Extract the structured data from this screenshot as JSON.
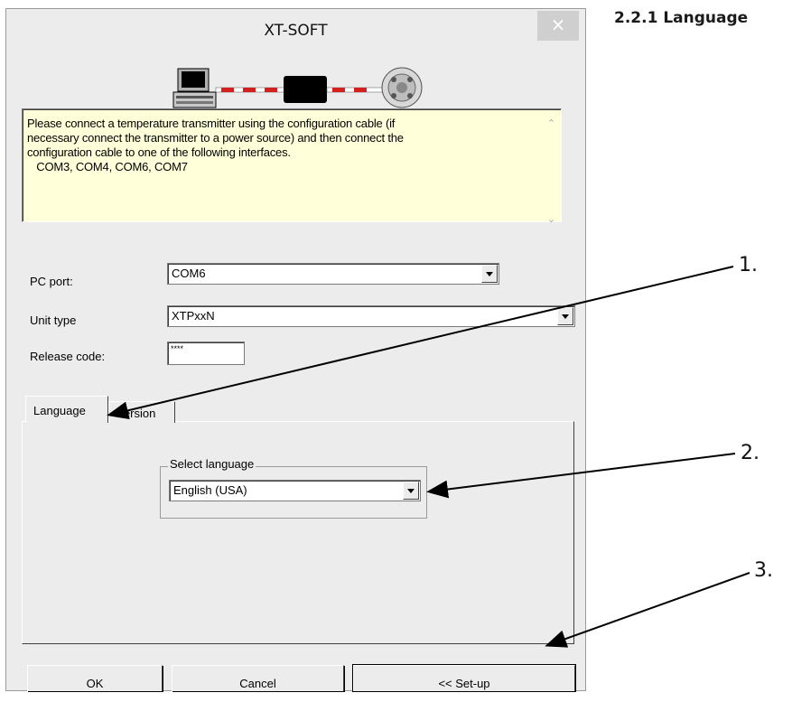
{
  "page": {
    "heading": "2.2.1 Language"
  },
  "window": {
    "title": "XT-SOFT",
    "close_glyph": "×",
    "connection_diagram_icon": "pc-cable-transmitter-diagram"
  },
  "info": {
    "text": "Please connect a temperature transmitter using the configuration cable (if\nnecessary connect the transmitter to a power source) and then connect the\nconfiguration cable to one of the following interfaces.\n   COM3, COM4, COM6, COM7"
  },
  "form": {
    "pc_port_label": "PC port:",
    "pc_port_value": "COM6",
    "unit_type_label": "Unit type",
    "unit_type_value": "XTPxxN",
    "release_code_label": "Release code:",
    "release_code_value": "****"
  },
  "tabs": [
    {
      "label": "Language",
      "active": true
    },
    {
      "label": "Version",
      "active": false
    }
  ],
  "language_group": {
    "label": "Select language",
    "value": "English (USA)"
  },
  "buttons": {
    "ok": "OK",
    "cancel": "Cancel",
    "setup": "<< Set-up"
  },
  "callouts": [
    "1.",
    "2.",
    "3."
  ],
  "colors": {
    "info_background": "#ffffd9",
    "window_background": "#ececec",
    "cable_red": "#d52020"
  }
}
